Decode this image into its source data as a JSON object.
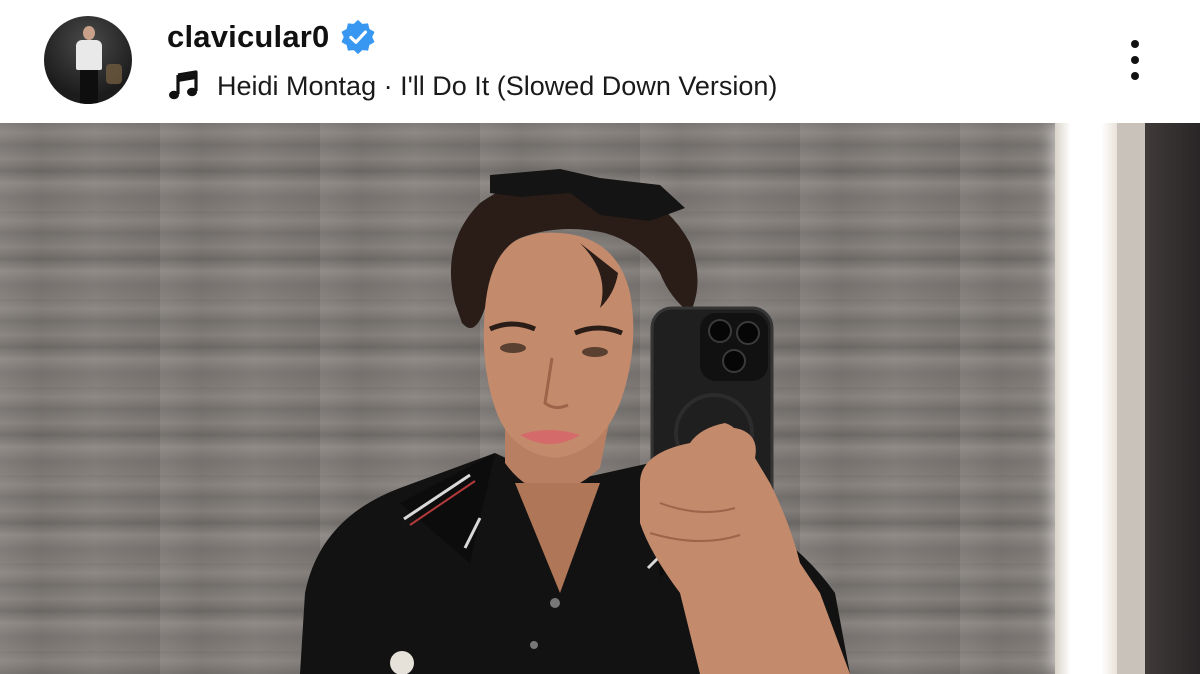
{
  "post": {
    "username": "clavicular0",
    "verified": true,
    "audio": {
      "text": "Heidi Montag · I'll Do It (Slowed Down Version)"
    },
    "icons": {
      "verified": "verified-badge-icon",
      "music": "music-note-icon",
      "more": "more-options-icon"
    },
    "colors": {
      "verified_blue": "#3897f0",
      "text": "#111111",
      "background": "#ffffff"
    }
  }
}
